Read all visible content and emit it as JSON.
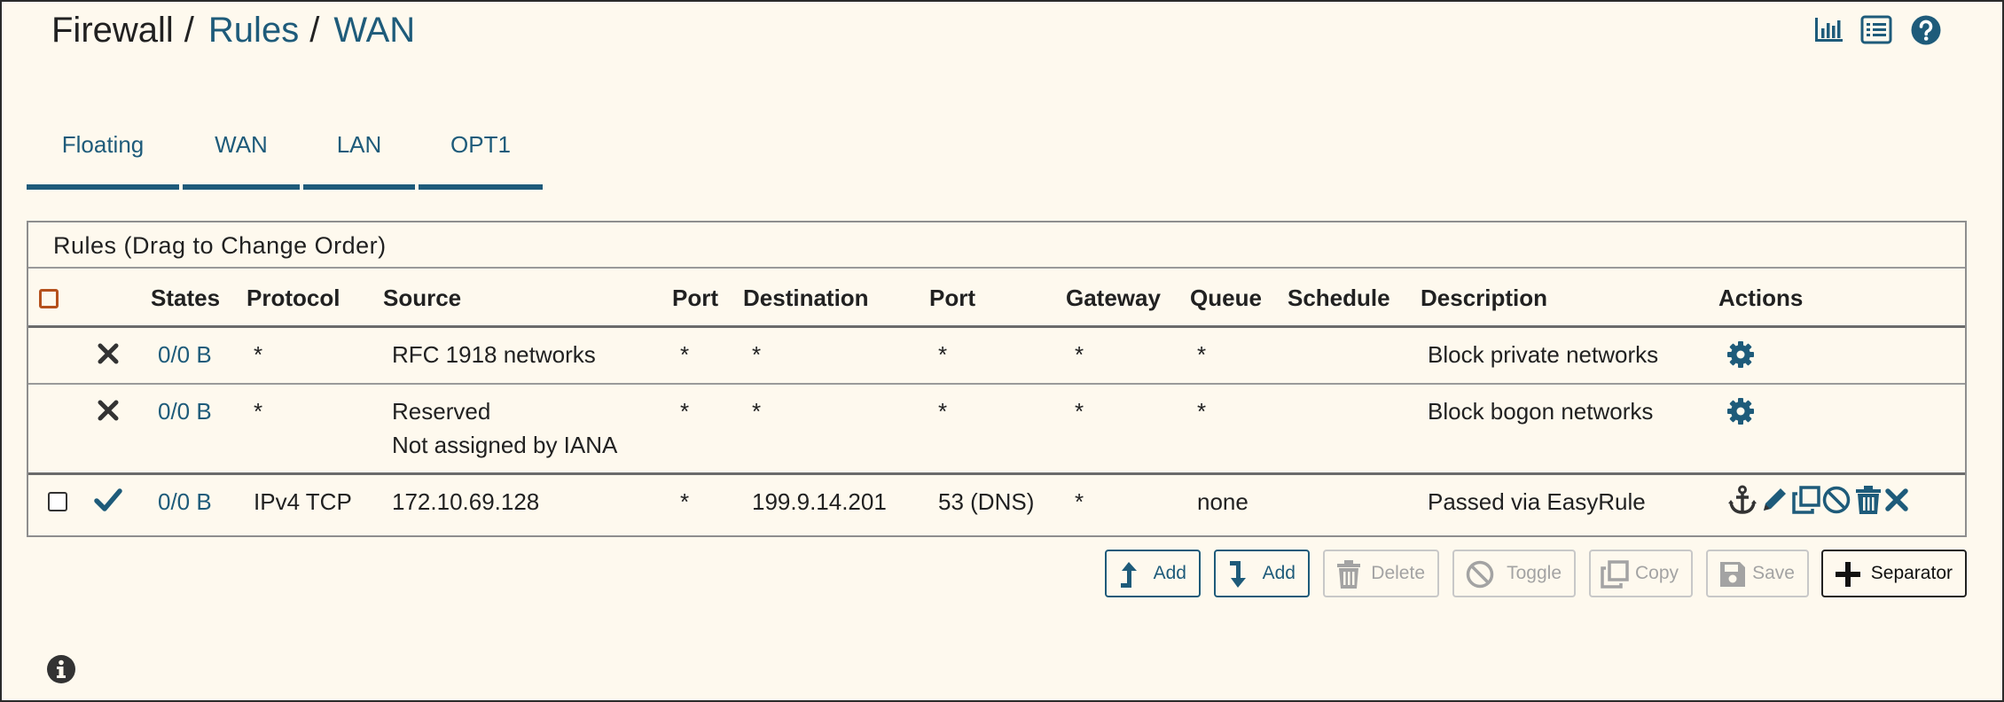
{
  "breadcrumb": [
    {
      "label": "Firewall",
      "link": false
    },
    {
      "label": "Rules",
      "link": true
    },
    {
      "label": "WAN",
      "link": true
    }
  ],
  "breadcrumb_separator": "/",
  "header_icons": [
    "bar-chart-icon",
    "list-icon",
    "help-icon"
  ],
  "tabs": [
    {
      "label": "Floating"
    },
    {
      "label": "WAN"
    },
    {
      "label": "LAN"
    },
    {
      "label": "OPT1"
    }
  ],
  "panel": {
    "title": "Rules (Drag to Change Order)"
  },
  "columns": {
    "states": "States",
    "protocol": "Protocol",
    "source": "Source",
    "port": "Port",
    "destination": "Destination",
    "dport": "Port",
    "gateway": "Gateway",
    "queue": "Queue",
    "schedule": "Schedule",
    "description": "Description",
    "actions": "Actions"
  },
  "rules": [
    {
      "status": "block",
      "states": "0/0 B",
      "protocol": "*",
      "source": "RFC 1918 networks",
      "source_sub": "",
      "port": "*",
      "destination": "*",
      "dport": "*",
      "gateway": "*",
      "queue": "*",
      "schedule": "",
      "description": "Block private networks",
      "actions": [
        "gear-icon"
      ]
    },
    {
      "status": "block",
      "states": "0/0 B",
      "protocol": "*",
      "source": "Reserved",
      "source_sub": "Not assigned by IANA",
      "port": "*",
      "destination": "*",
      "dport": "*",
      "gateway": "*",
      "queue": "*",
      "schedule": "",
      "description": "Block bogon networks",
      "actions": [
        "gear-icon"
      ]
    },
    {
      "status": "pass",
      "states": "0/0 B",
      "protocol": "IPv4 TCP",
      "source": "172.10.69.128",
      "source_sub": "",
      "port": "*",
      "destination": "199.9.14.201",
      "dport": "53 (DNS)",
      "gateway": "*",
      "queue": "none",
      "schedule": "",
      "description": "Passed via EasyRule",
      "actions": [
        "anchor-icon",
        "pencil-icon",
        "copy-icon",
        "disable-icon",
        "trash-icon",
        "delete-icon"
      ]
    }
  ],
  "buttons": {
    "add_top": "Add",
    "add_bottom": "Add",
    "delete": "Delete",
    "toggle": "Toggle",
    "copy": "Copy",
    "save": "Save",
    "separator": "Separator"
  },
  "colors": {
    "background": "#fef9ee",
    "accent": "#1e5b7a",
    "disabled": "#a3a3a3",
    "checkbox_highlight": "#b5501c"
  }
}
